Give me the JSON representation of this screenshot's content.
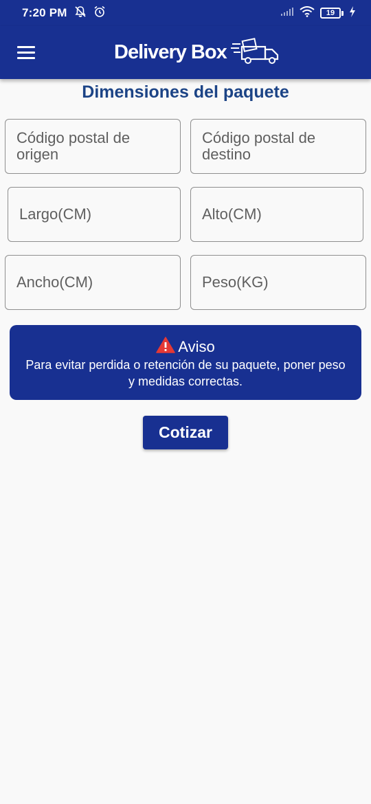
{
  "status_bar": {
    "time": "7:20 PM",
    "icons": [
      "notifications-off-icon",
      "alarm-icon",
      "signal-icon",
      "wifi-icon",
      "battery-icon",
      "charging-icon"
    ],
    "battery_level": "19"
  },
  "app_bar": {
    "menu_icon": "hamburger-menu-icon",
    "brand_name": "Delivery Box",
    "logo_icon": "delivery-truck-icon"
  },
  "page_title": "Dimensiones del paquete",
  "fields": {
    "origin_zip": {
      "placeholder": "Código postal de origen",
      "value": ""
    },
    "destination_zip": {
      "placeholder": "Código postal de destino",
      "value": ""
    },
    "length": {
      "placeholder": "Largo(CM)",
      "value": ""
    },
    "height": {
      "placeholder": "Alto(CM)",
      "value": ""
    },
    "width": {
      "placeholder": "Ancho(CM)",
      "value": ""
    },
    "weight": {
      "placeholder": "Peso(KG)",
      "value": ""
    }
  },
  "notice": {
    "icon": "warning-icon",
    "title": "Aviso",
    "message": "Para evitar perdida o retención de su paquete, poner peso y medidas correctas."
  },
  "quote_button_label": "Cotizar",
  "colors": {
    "primary": "#183091",
    "title_text": "#1c4486",
    "warning": "#e53935",
    "background": "#f9f9f9"
  }
}
